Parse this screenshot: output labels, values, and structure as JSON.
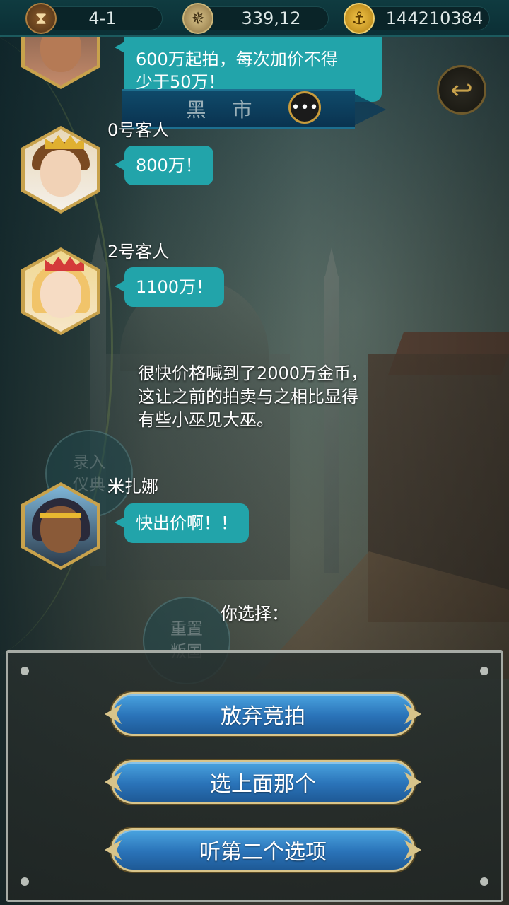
{
  "topbar": {
    "level": "4-1",
    "position": "339,12",
    "gold": "144210384",
    "level_icon": "hourglass-icon",
    "position_icon": "compass-icon",
    "gold_icon": "anchor-icon"
  },
  "banner": {
    "title": "黑 市",
    "chat_icon": "speech-bubble-icon"
  },
  "back_icon": "back-arrow-icon",
  "messages": [
    {
      "speaker": "",
      "text_lines": [
        "600万起拍，每次加价不得",
        "少于50万！"
      ]
    },
    {
      "speaker": "0号客人",
      "text": "800万！"
    },
    {
      "speaker": "2号客人",
      "text": "1100万！"
    },
    {
      "speaker": "米扎娜",
      "text": "快出价啊！！"
    }
  ],
  "narration": "很快价格喊到了2000万金币，这让之前的拍卖与之相比显得有些小巫见大巫。",
  "ghost_buttons": {
    "top": "录入\n仪典",
    "bottom_line1": "重置",
    "bottom_line2": "叛国"
  },
  "prompt": "你选择：",
  "choices": [
    {
      "label": "放弃竞拍"
    },
    {
      "label": "选上面那个"
    },
    {
      "label": "听第二个选项"
    }
  ],
  "colors": {
    "bubble": "#22a4aa",
    "topbar": "#0f3b40",
    "choice_button": "#2a73b8",
    "gold_trim": "#d8c48a"
  }
}
